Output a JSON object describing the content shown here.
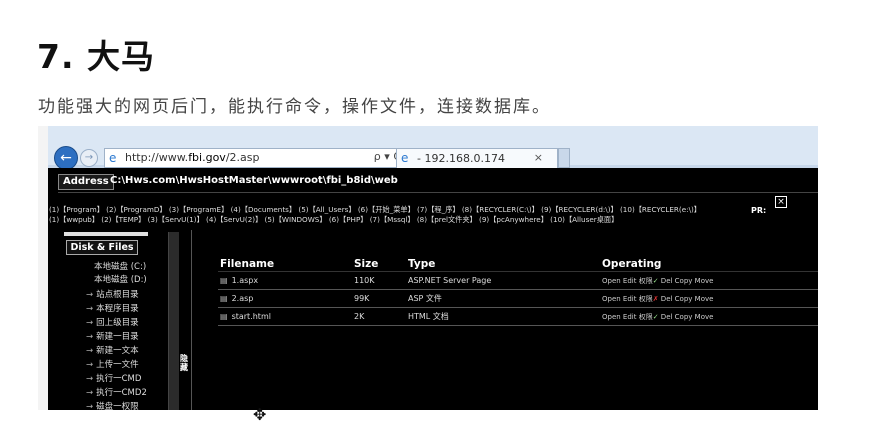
{
  "heading": "7. 大马",
  "description": "功能强大的网页后门，能执行命令，操作文件，连接数据库。",
  "browser": {
    "url_prefix": "http://www.",
    "url_domain": "fbi.gov",
    "url_suffix": "/2.asp",
    "tool_search": "ρ",
    "tool_dropdown": "▾",
    "tool_refresh": "C",
    "tab_title": "- 192.168.0.174",
    "tab_close": "×"
  },
  "shell": {
    "address_label": "Address",
    "address_path": "C:\\Hws.com\\HwsHostMaster\\wwwroot\\fbi_b8id\\web",
    "links_row1": "(1)【Program】 (2)【ProgramD】 (3)【ProgramE】 (4)【Documents】 (5)【All_Users】 (6)【开始_菜单】 (7)【程_序】 (8)【RECYCLER(C:\\)】 (9)【RECYCLER(d:\\)】 (10)【RECYCLER(e:\\)】",
    "links_row2": "(1)【wwpub】 (2)【TEMP】 (3)【ServU(1)】 (4)【ServU(2)】 (5)【WINDOWS】 (6)【PHP】 (7)【Mssql】 (8)【prel文件夹】 (9)【pcAnywhere】 (10)【Alluser桌面】",
    "pr_label": "PR:",
    "close_mark": "×",
    "sidebar_title": "Disk & Files",
    "sidebar_items": [
      {
        "icon": "",
        "label": "本地磁盘 (C:)"
      },
      {
        "icon": "",
        "label": "本地磁盘 (D:)"
      },
      {
        "icon": "→",
        "label": "站点根目录"
      },
      {
        "icon": "→",
        "label": "本程序目录"
      },
      {
        "icon": "→",
        "label": "回上级目录"
      },
      {
        "icon": "→",
        "label": "新建一目录"
      },
      {
        "icon": "→",
        "label": "新建一文本"
      },
      {
        "icon": "→",
        "label": "上传一文件"
      },
      {
        "icon": "→",
        "label": "执行一CMD"
      },
      {
        "icon": "→",
        "label": "执行一CMD2"
      },
      {
        "icon": "→",
        "label": "磁盘一权限"
      }
    ],
    "hide_label": "隐藏",
    "table_headers": [
      "Filename",
      "Size",
      "Type",
      "Operating"
    ],
    "files": [
      {
        "name": "1.aspx",
        "size": "110K",
        "type": "ASP.NET Server Page",
        "op_pre": "Open Edit 权限",
        "op_mark": "✓",
        "op_post": " Del Copy Move"
      },
      {
        "name": "2.asp",
        "size": "99K",
        "type": "ASP 文件",
        "op_pre": "Open Edit 权限",
        "op_mark": "✗",
        "op_post": " Del Copy Move"
      },
      {
        "name": "start.html",
        "size": "2K",
        "type": "HTML 文档",
        "op_pre": "Open Edit 权限",
        "op_mark": "✓",
        "op_post": " Del Copy Move"
      }
    ]
  }
}
